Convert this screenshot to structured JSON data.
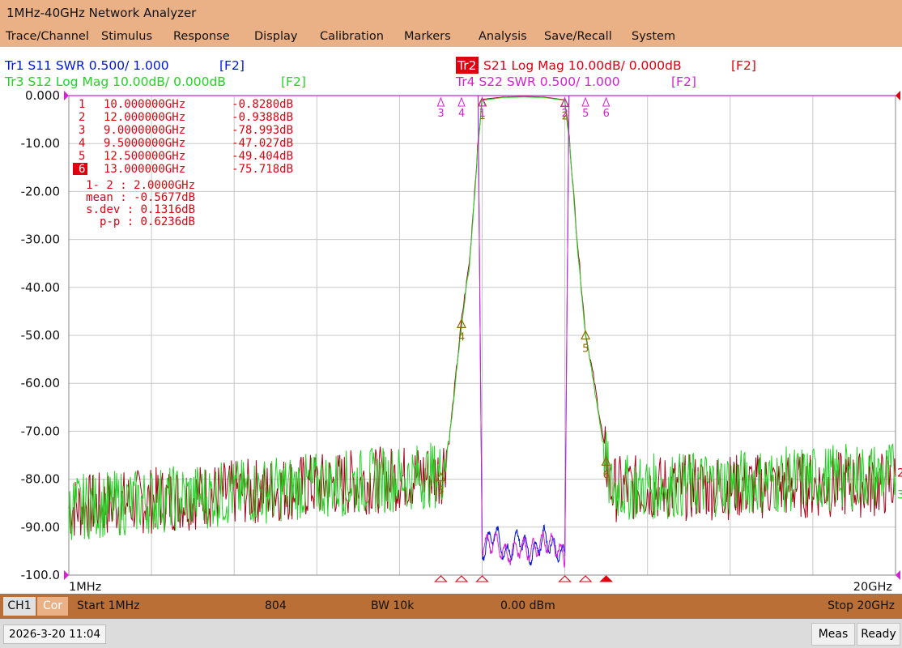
{
  "window": {
    "title": "1MHz-40GHz Network Analyzer"
  },
  "menu": [
    "Trace/Channel",
    "Stimulus",
    "Response",
    "Display",
    "Calibration",
    "Markers",
    "Analysis",
    "Save/Recall",
    "System"
  ],
  "traces": [
    {
      "id": "Tr1",
      "text": "Tr1 S11 SWR 0.500/ 1.000",
      "tag": "[F2]",
      "color": "#0018d8",
      "active": false
    },
    {
      "id": "Tr2",
      "text": "S21 Log Mag 10.00dB/ 0.000dB",
      "tag": "[F2]",
      "color": "#e00010",
      "active": true
    },
    {
      "id": "Tr3",
      "text": "Tr3 S12 Log Mag 10.00dB/ 0.000dB",
      "tag": "[F2]",
      "color": "#22d422",
      "active": false
    },
    {
      "id": "Tr4",
      "text": "Tr4 S22 SWR 0.500/ 1.000",
      "tag": "[F2]",
      "color": "#d81ed8",
      "active": false
    }
  ],
  "colors": {
    "grid": "#c8c8c8",
    "frame": "#888888",
    "marker_text": "#e00010",
    "marker_tri": "#e00010",
    "s11": "#0018d8",
    "s21": "#a30016",
    "s12": "#22d422",
    "s22": "#d81ed8",
    "ref": "#d81ed8",
    "active_marker_bg": "#e00010"
  },
  "chart_data": {
    "type": "line",
    "x_unit": "GHz",
    "xlim": [
      0.001,
      20
    ],
    "ylim": [
      -100,
      0
    ],
    "y_ticks": [
      "0.000",
      "-10.00",
      "-20.00",
      "-30.00",
      "-40.00",
      "-50.00",
      "-60.00",
      "-70.00",
      "-80.00",
      "-90.00",
      "-100.0"
    ],
    "x_start_label": "1MHz",
    "x_stop_label": "20GHz",
    "grid": true,
    "series": [
      {
        "name": "S21",
        "x": [
          0.001,
          9.0,
          9.2,
          9.5,
          9.7,
          9.9,
          10.0,
          10.5,
          11.0,
          11.5,
          12.0,
          12.1,
          12.3,
          12.5,
          12.7,
          13.0,
          13.1,
          20.0
        ],
        "y": [
          -86,
          -79,
          -72,
          -47,
          -34,
          -10,
          -0.8,
          -0.3,
          -0.2,
          -0.3,
          -0.9,
          -8,
          -30,
          -49.4,
          -59,
          -75.7,
          -82,
          -81
        ]
      },
      {
        "name": "S12",
        "x": [
          0.001,
          9.0,
          9.2,
          9.5,
          9.7,
          9.9,
          10.0,
          10.5,
          11.0,
          11.5,
          12.0,
          12.1,
          12.3,
          12.5,
          12.7,
          13.0,
          13.1,
          20.0
        ],
        "y": [
          -86,
          -79,
          -72,
          -48,
          -35,
          -10.5,
          -1.0,
          -0.4,
          -0.3,
          -0.4,
          -1.0,
          -8.5,
          -31,
          -50,
          -60,
          -76.5,
          -82,
          -79
        ]
      },
      {
        "name": "S11",
        "x": [
          9.9,
          10.0,
          10.3,
          10.6,
          10.9,
          11.2,
          11.5,
          11.8,
          12.0,
          12.1
        ],
        "y": [
          0,
          -95,
          -91,
          -96,
          -92,
          -96,
          -92,
          -95,
          -96,
          0
        ]
      },
      {
        "name": "S22",
        "x": [
          9.9,
          10.0,
          10.3,
          10.6,
          10.9,
          11.2,
          11.5,
          11.8,
          12.0,
          12.1
        ],
        "y": [
          0,
          -94,
          -93,
          -96,
          -94,
          -95,
          -93,
          -94,
          -97,
          0
        ]
      }
    ],
    "markers": [
      {
        "n": "1",
        "freq": "10.000000GHz",
        "val": "-0.8280dB",
        "x": 10.0,
        "y": -0.828,
        "active": false
      },
      {
        "n": "2",
        "freq": "12.000000GHz",
        "val": "-0.9388dB",
        "x": 12.0,
        "y": -0.9388,
        "active": false
      },
      {
        "n": "3",
        "freq": "9.0000000GHz",
        "val": "-78.993dB",
        "x": 9.0,
        "y": -78.993,
        "active": false
      },
      {
        "n": "4",
        "freq": "9.5000000GHz",
        "val": "-47.027dB",
        "x": 9.5,
        "y": -47.027,
        "active": false
      },
      {
        "n": "5",
        "freq": "12.500000GHz",
        "val": "-49.404dB",
        "x": 12.5,
        "y": -49.404,
        "active": false
      },
      {
        "n": "6",
        "freq": "13.000000GHz",
        "val": "-75.718dB",
        "x": 13.0,
        "y": -75.718,
        "active": true
      }
    ],
    "stats": [
      "1- 2 : 2.0000GHz",
      "mean : -0.5677dB",
      "s.dev : 0.1316dB",
      "p-p : 0.6236dB"
    ],
    "trace_end_labels": [
      "2",
      "3"
    ]
  },
  "status": {
    "ch": "CH1",
    "cor": "Cor",
    "start": "Start 1MHz",
    "points": "804",
    "bw": "BW 10k",
    "power": "0.00 dBm",
    "stop": "Stop 20GHz"
  },
  "bottom": {
    "datetime": "2026-3-20 11:04",
    "meas": "Meas",
    "ready": "Ready"
  }
}
